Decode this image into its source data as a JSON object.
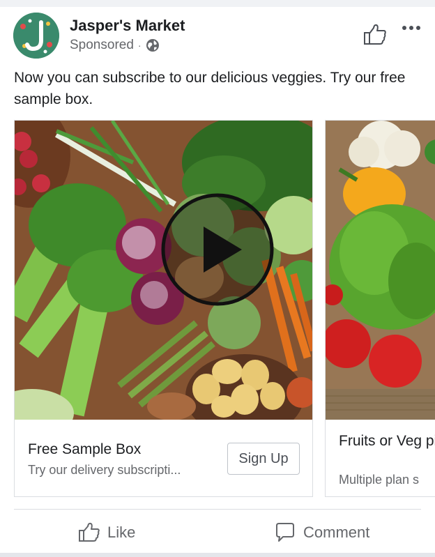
{
  "post": {
    "page_name": "Jasper's Market",
    "sponsored_label": "Sponsored",
    "separator": "·",
    "body_text": "Now you can subscribe to our delicious veggies. Try our free sample box.",
    "avatar_letter": "J"
  },
  "carousel": {
    "cards": [
      {
        "title": "Free Sample Box",
        "description": "Try our delivery subscripti...",
        "cta_label": "Sign Up",
        "has_video": true
      },
      {
        "title": "Fruits or Veg pick",
        "description": "Multiple plan s"
      }
    ]
  },
  "actions": {
    "like_label": "Like",
    "comment_label": "Comment"
  },
  "icons": {
    "page_like": "thumbs-up-icon",
    "more": "more-options-icon",
    "audience": "globe-icon",
    "play": "play-icon"
  },
  "colors": {
    "avatar_bg": "#3b8a6e",
    "secondary_text": "#65676b",
    "primary_text": "#1c1e21"
  }
}
